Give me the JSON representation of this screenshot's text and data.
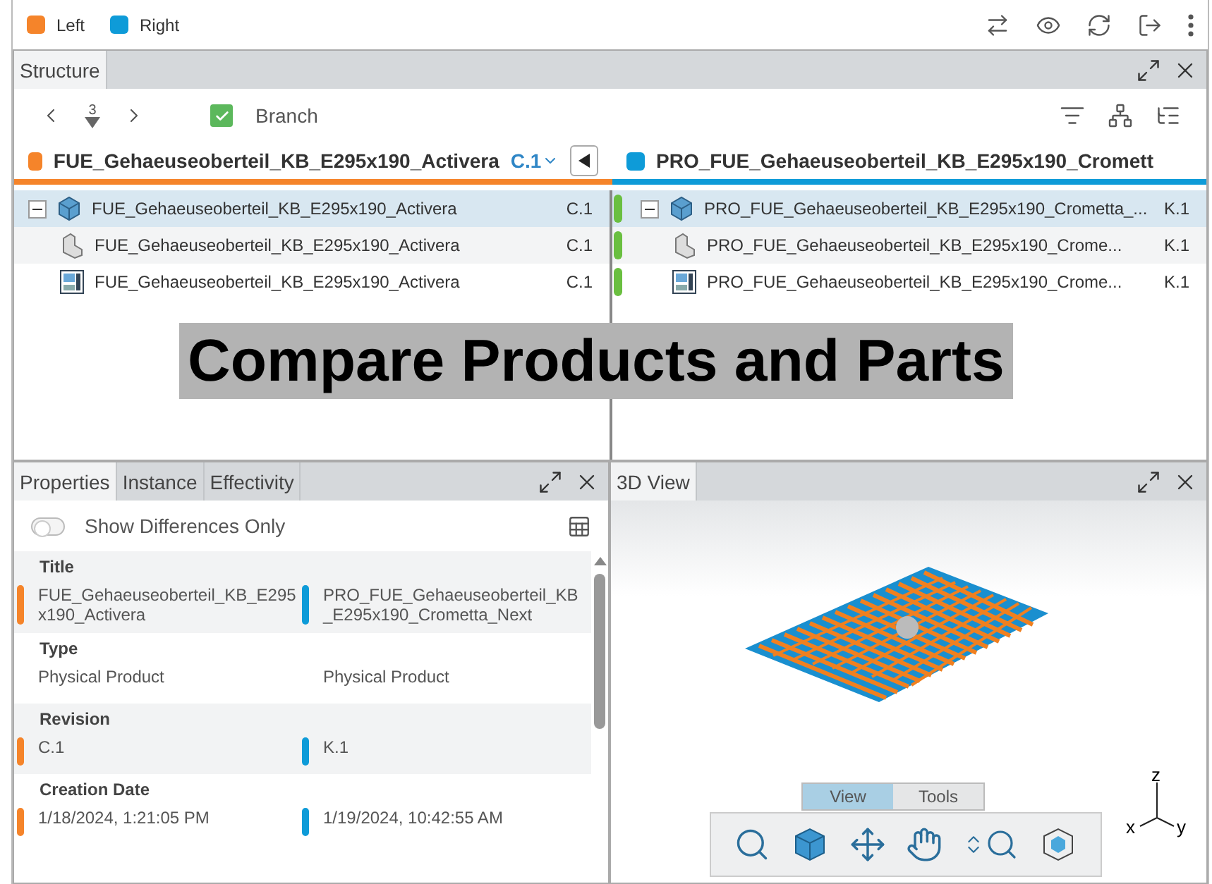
{
  "legend": [
    {
      "label": "Left",
      "color": "#f5842a"
    },
    {
      "label": "Right",
      "color": "#0e9bd8"
    }
  ],
  "structure": {
    "tabs": [
      {
        "label": "Structure",
        "selected": true
      }
    ],
    "level": "3",
    "branch": {
      "label": "Branch",
      "checked": true
    },
    "left": {
      "title": "FUE_Gehaeuseoberteil_KB_E295x190_Activera",
      "revision": "C.1",
      "tree": [
        {
          "kind": "assembly",
          "name": "FUE_Gehaeuseoberteil_KB_E295x190_Activera",
          "revision": "C.1",
          "selected": true,
          "expanded": true,
          "matched": false,
          "children": [
            {
              "kind": "part",
              "name": "FUE_Gehaeuseoberteil_KB_E295x190_Activera",
              "revision": "C.1",
              "selected": false,
              "matched": false
            },
            {
              "kind": "drawing",
              "name": "FUE_Gehaeuseoberteil_KB_E295x190_Activera",
              "revision": "C.1",
              "selected": false,
              "matched": false
            }
          ]
        }
      ]
    },
    "right": {
      "title": "PRO_FUE_Gehaeuseoberteil_KB_E295x190_Cromett",
      "tree": [
        {
          "kind": "assembly",
          "name": "PRO_FUE_Gehaeuseoberteil_KB_E295x190_Crometta_...",
          "revision": "K.1",
          "selected": true,
          "expanded": true,
          "matched": true,
          "children": [
            {
              "kind": "part",
              "name": "PRO_FUE_Gehaeuseoberteil_KB_E295x190_Crome...",
              "revision": "K.1",
              "selected": false,
              "matched": true
            },
            {
              "kind": "drawing",
              "name": "PRO_FUE_Gehaeuseoberteil_KB_E295x190_Crome...",
              "revision": "K.1",
              "selected": false,
              "matched": true
            }
          ]
        }
      ]
    }
  },
  "caption": "Compare Products and Parts",
  "properties": {
    "tabs": [
      {
        "label": "Properties",
        "selected": true
      },
      {
        "label": "Instance",
        "selected": false
      },
      {
        "label": "Effectivity",
        "selected": false
      }
    ],
    "show_differences": {
      "label": "Show Differences Only",
      "on": false
    },
    "rows": [
      {
        "label": "Title",
        "left": "FUE_Gehaeuseoberteil_KB_E295x190_Activera",
        "right": "PRO_FUE_Gehaeuseoberteil_KB_E295x190_Crometta_Next",
        "different": true
      },
      {
        "label": "Type",
        "left": "Physical Product",
        "right": "Physical Product",
        "different": false
      },
      {
        "label": "Revision",
        "left": "C.1",
        "right": "K.1",
        "different": true
      },
      {
        "label": "Creation Date",
        "left": "1/18/2024, 1:21:05 PM",
        "right": "1/19/2024, 10:42:55 AM",
        "different": true
      }
    ]
  },
  "view3d": {
    "tabs": [
      {
        "label": "3D View",
        "selected": true
      }
    ],
    "axes": [
      "x",
      "y",
      "z"
    ],
    "toolbar_tabs": [
      {
        "label": "View",
        "selected": true
      },
      {
        "label": "Tools",
        "selected": false
      }
    ]
  }
}
